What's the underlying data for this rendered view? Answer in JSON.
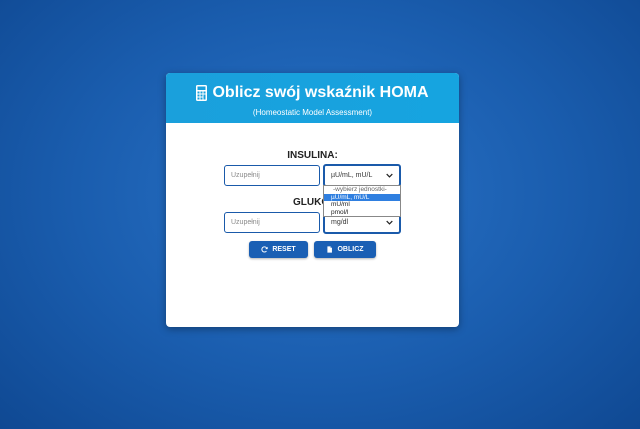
{
  "header": {
    "title": "Oblicz swój wskaźnik HOMA",
    "subtitle": "(Homeostatic Model Assessment)",
    "icon": "calculator-icon"
  },
  "insulin": {
    "label": "INSULINA:",
    "input_placeholder": "Uzupełnij",
    "unit_selected": "µU/mL, mU/L",
    "unit_options": [
      "-wybierz jednostki-",
      "µU/mL, mU/L",
      "mU/ml",
      "pmol/l"
    ]
  },
  "glucose": {
    "label": "GLUKOZ",
    "input_placeholder": "Uzupełnij",
    "unit_selected": "mg/dl"
  },
  "buttons": {
    "reset_label": "RESET",
    "calculate_label": "OBLICZ"
  },
  "colors": {
    "header": "#1aa0dc",
    "button": "#1a5fb4",
    "field_border": "#1a5aaa",
    "selected_option": "#2f7fe0"
  }
}
